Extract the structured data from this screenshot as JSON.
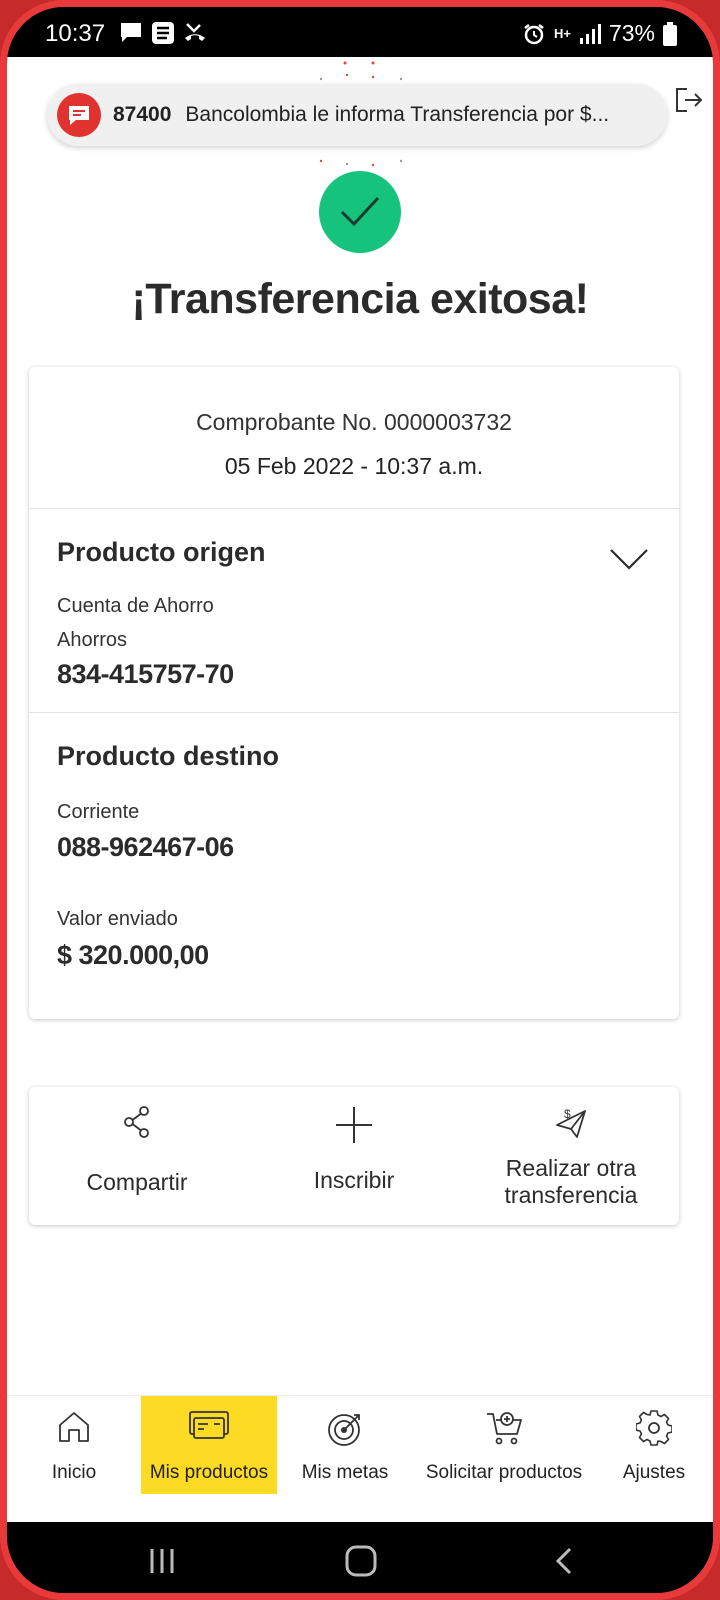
{
  "status_bar": {
    "time": "10:37",
    "network": "H+",
    "battery": "73%"
  },
  "notification": {
    "sender": "87400",
    "text": "Bancolombia le informa Transferencia por $..."
  },
  "title": "¡Transferencia exitosa!",
  "receipt": {
    "voucher": "Comprobante No. 0000003732",
    "date": "05 Feb 2022 - 10:37 a.m."
  },
  "origin": {
    "title": "Producto origen",
    "account_type": "Cuenta de Ahorro",
    "subtype": "Ahorros",
    "number": "834-415757-70"
  },
  "destination": {
    "title": "Producto destino",
    "account_type": "Corriente",
    "number": "088-962467-06"
  },
  "amount": {
    "label": "Valor enviado",
    "value": "$ 320.000,00"
  },
  "actions": [
    {
      "label": "Compartir",
      "icon": "share-icon"
    },
    {
      "label": "Inscribir",
      "icon": "plus-icon"
    },
    {
      "label_line1": "Realizar otra",
      "label_line2": "transferencia",
      "icon": "send-money-icon"
    }
  ],
  "nav": [
    {
      "label": "Inicio",
      "icon": "home-icon"
    },
    {
      "label": "Mis productos",
      "icon": "cards-icon",
      "active": true
    },
    {
      "label": "Mis metas",
      "icon": "target-icon"
    },
    {
      "label": "Solicitar productos",
      "icon": "cart-plus-icon"
    },
    {
      "label": "Ajustes",
      "icon": "gear-icon"
    }
  ],
  "colors": {
    "success": "#15c37d",
    "active_nav": "#fdda24",
    "notification_icon": "#e0322f",
    "frame": "#e83a3a"
  }
}
